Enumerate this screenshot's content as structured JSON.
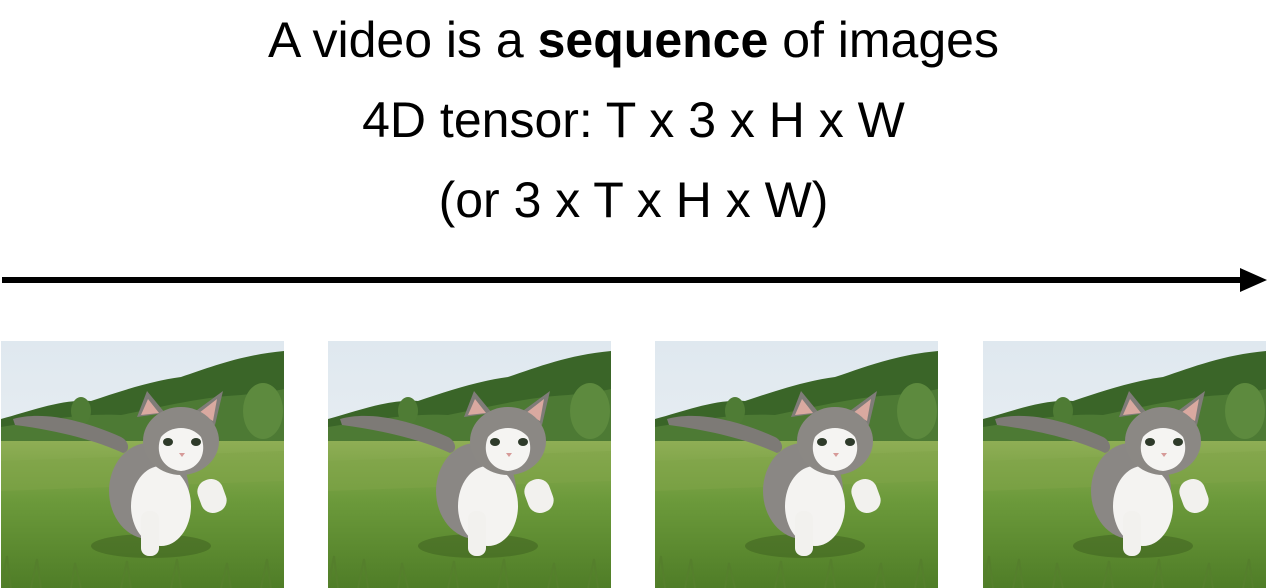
{
  "title": {
    "line1_prefix": "A video is a ",
    "line1_bold": "sequence",
    "line1_suffix": " of images",
    "line2": "4D tensor: T x 3 x H x W",
    "line3": "(or 3 x T x H x W)"
  },
  "frames": [
    {
      "name": "kitten-frame-1"
    },
    {
      "name": "kitten-frame-2"
    },
    {
      "name": "kitten-frame-3"
    },
    {
      "name": "kitten-frame-4"
    }
  ],
  "colors": {
    "sky": "#e8eef3",
    "trees": "#3f6a2c",
    "grass": "#6f9a3c",
    "arrow": "#000000"
  }
}
